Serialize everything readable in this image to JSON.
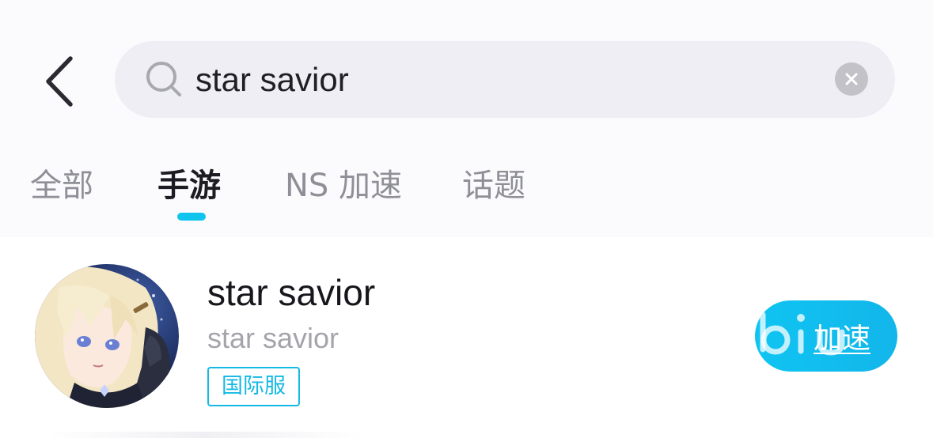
{
  "search": {
    "query": "star savior"
  },
  "tabs": [
    {
      "label": "全部",
      "active": false
    },
    {
      "label": "手游",
      "active": true
    },
    {
      "label": "NS 加速",
      "active": false
    },
    {
      "label": "话题",
      "active": false
    }
  ],
  "result": {
    "title": "star savior",
    "subtitle": "star savior",
    "server_tag": "国际服",
    "action_label": "加速"
  },
  "icons": {
    "back": "chevron-left-icon",
    "search": "search-icon",
    "clear": "clear-icon"
  },
  "colors": {
    "accent": "#10c4ee",
    "search_bg": "#eeeef4",
    "tab_inactive": "#8f8f97",
    "tab_active": "#1c1c22",
    "subtitle": "#a4a4ab"
  }
}
